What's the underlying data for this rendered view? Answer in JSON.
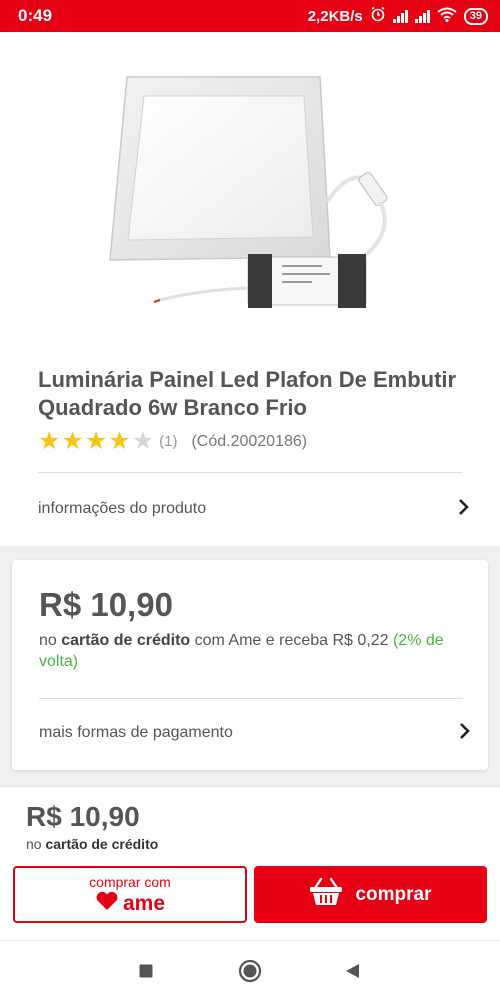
{
  "status_bar": {
    "time": "0:49",
    "speed": "2,2KB/s",
    "battery": "39"
  },
  "product": {
    "title": "Luminária Painel Led Plafon De Embutir Quadrado 6w Branco Frio",
    "rating": 4,
    "rating_max": 5,
    "rating_count": "(1)",
    "code": "(Cód.20020186)",
    "info_label": "informações do produto"
  },
  "price_card": {
    "price": "R$ 10,90",
    "desc_prefix": "no ",
    "desc_bold": "cartão de crédito",
    "desc_mid": " com Ame e receba R$ 0,22 ",
    "desc_green": "(2% de volta)",
    "more_payments": "mais formas de pagamento"
  },
  "bottom_bar": {
    "price": "R$ 10,90",
    "sub_prefix": "no ",
    "sub_bold": "cartão de crédito",
    "ame_button_top": "comprar com",
    "ame_brand": "ame",
    "buy_label": "comprar"
  },
  "colors": {
    "brand_red": "#e60014",
    "star_yellow": "#f5c518",
    "cashback_green": "#4bb543"
  },
  "icons": {
    "alarm": "alarm-icon",
    "signal": "signal-icon",
    "wifi": "wifi-icon",
    "battery": "battery-icon",
    "chevron": "chevron-right-icon",
    "cart": "shopping-basket-icon",
    "heart": "heart-icon",
    "nav_recent": "square-icon",
    "nav_home": "circle-icon",
    "nav_back": "triangle-back-icon"
  }
}
